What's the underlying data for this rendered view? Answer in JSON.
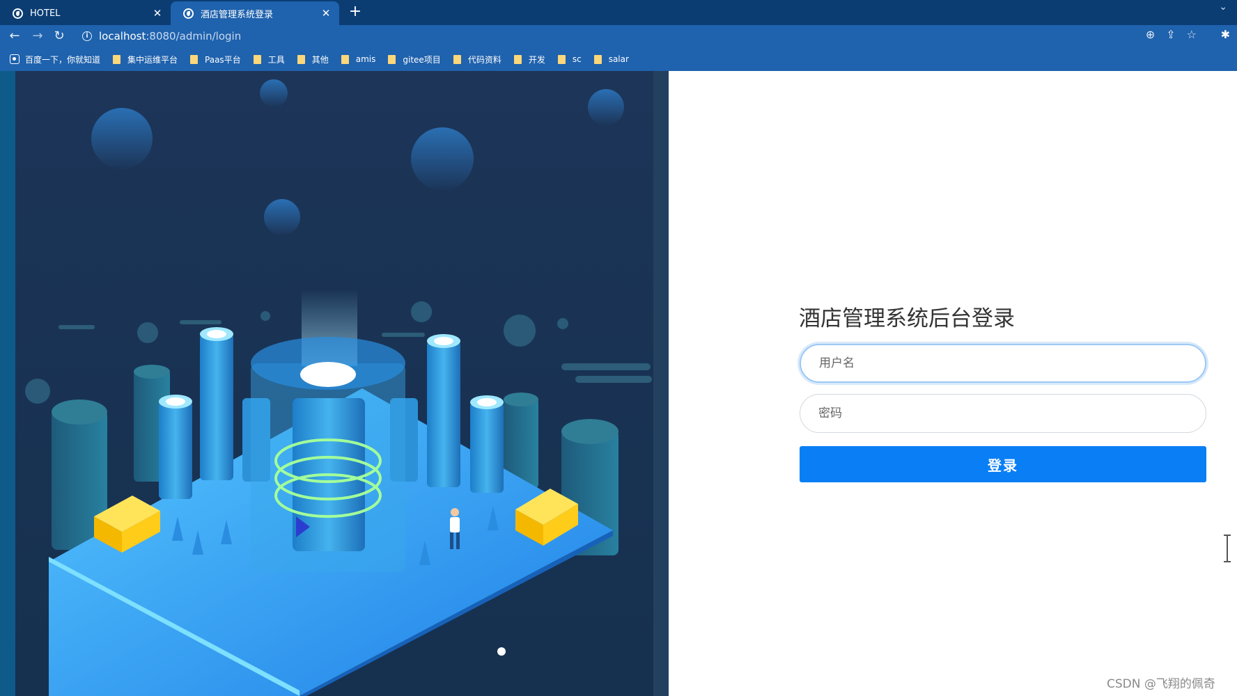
{
  "browser": {
    "tabs": [
      {
        "title": "HOTEL",
        "active": false
      },
      {
        "title": "酒店管理系统登录",
        "active": true
      }
    ],
    "new_tab_icon": "plus-icon",
    "tab_menu_icon": "chevron-down-icon",
    "address": {
      "host": "localhost",
      "rest": ":8080/admin/login"
    },
    "bookmarks": [
      {
        "label": "百度一下，你就知道",
        "icon": "baidu-icon"
      },
      {
        "label": "集中运维平台",
        "icon": "folder-icon"
      },
      {
        "label": "Paas平台",
        "icon": "folder-icon"
      },
      {
        "label": "工具",
        "icon": "folder-icon"
      },
      {
        "label": "其他",
        "icon": "folder-icon"
      },
      {
        "label": "amis",
        "icon": "folder-icon"
      },
      {
        "label": "gitee项目",
        "icon": "folder-icon"
      },
      {
        "label": "代码资料",
        "icon": "folder-icon"
      },
      {
        "label": "开发",
        "icon": "folder-icon"
      },
      {
        "label": "sc",
        "icon": "folder-icon"
      },
      {
        "label": "salar",
        "icon": "folder-icon"
      }
    ]
  },
  "login": {
    "title": "酒店管理系统后台登录",
    "username_placeholder": "用户名",
    "password_placeholder": "密码",
    "submit_label": "登录"
  },
  "watermark": "CSDN @飞翔的佩奇",
  "colors": {
    "chrome_dark": "#0b3d73",
    "chrome": "#1f62ad",
    "illustration_bg": "#1c3558",
    "button": "#0a7ff5"
  }
}
